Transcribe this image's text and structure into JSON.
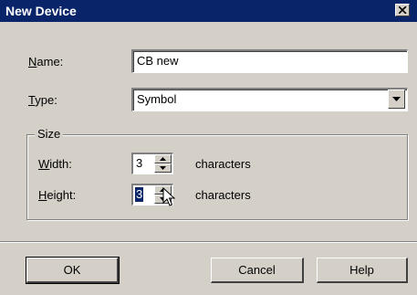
{
  "window": {
    "title": "New Device",
    "close_icon": "close-icon"
  },
  "fields": {
    "name_label": "Name:",
    "name_value": "CB new",
    "type_label": "Type:",
    "type_value": "Symbol"
  },
  "size_group": {
    "label": "Size",
    "width_label": "Width:",
    "width_value": "3",
    "width_unit": "characters",
    "height_label": "Height:",
    "height_value": "3",
    "height_unit": "characters"
  },
  "buttons": {
    "ok": "OK",
    "cancel": "Cancel",
    "help": "Help"
  },
  "colors": {
    "titlebar": "#0a246a",
    "dialog_bg": "#d4d0c8",
    "selection": "#0a246a"
  }
}
